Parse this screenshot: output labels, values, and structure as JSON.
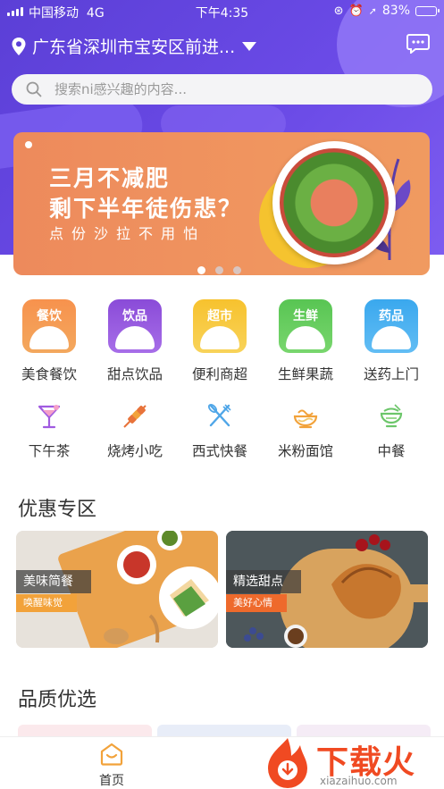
{
  "status_bar": {
    "carrier": "中国移动",
    "network": "4G",
    "time": "下午4:35",
    "battery": "83%"
  },
  "header": {
    "location": "广东省深圳市宝安区前进...",
    "search_placeholder": "搜索ni感兴趣的内容..."
  },
  "banner": {
    "line1": "三月不减肥",
    "line2": "剩下半年徒伤悲？",
    "line3": "点份沙拉不用怕",
    "page_count": 3,
    "current_page": 1
  },
  "categories": [
    {
      "tag": "餐饮",
      "label": "美食餐饮",
      "color_top": "#f7924d",
      "color_bottom": "#f3a85e"
    },
    {
      "tag": "饮品",
      "label": "甜点饮品",
      "color_top": "#8a4bd8",
      "color_bottom": "#a76ee8"
    },
    {
      "tag": "超市",
      "label": "便利商超",
      "color_top": "#f7c22e",
      "color_bottom": "#f8d35a"
    },
    {
      "tag": "生鲜",
      "label": "生鲜果蔬",
      "color_top": "#58c553",
      "color_bottom": "#79d66e"
    },
    {
      "tag": "药品",
      "label": "送药上门",
      "color_top": "#3aa8ee",
      "color_bottom": "#62bdf4"
    }
  ],
  "sub_categories": [
    {
      "label": "下午茶",
      "icon": "cocktail-glass-icon"
    },
    {
      "label": "烧烤小吃",
      "icon": "skewer-icon"
    },
    {
      "label": "西式快餐",
      "icon": "fork-knife-icon"
    },
    {
      "label": "米粉面馆",
      "icon": "noodle-bowl-icon"
    },
    {
      "label": "中餐",
      "icon": "rice-bowl-icon"
    }
  ],
  "sections": {
    "promo_title": "优惠专区",
    "quality_title": "品质优选"
  },
  "promos": [
    {
      "title": "美味简餐",
      "subtitle": "唤醒味觉",
      "sub_color": "#f2a23a"
    },
    {
      "title": "精选甜点",
      "subtitle": "美好心情",
      "sub_color": "#ee6a2c"
    }
  ],
  "tabbar": {
    "home_label": "首页"
  },
  "watermark": {
    "name": "下载火",
    "url": "xiazaihuo.com"
  },
  "colors": {
    "hero_purple": "#5b3fd6",
    "accent_orange": "#f2a23a",
    "sub_icon_purple": "#a05be0",
    "sub_icon_orange": "#f2a23a",
    "sub_icon_blue": "#4fa6e8",
    "sub_icon_green": "#6cc66a"
  }
}
